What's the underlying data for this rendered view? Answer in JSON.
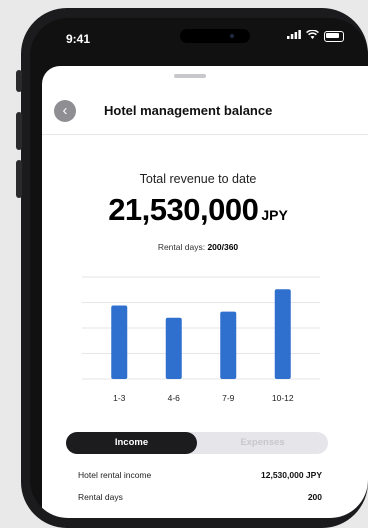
{
  "status": {
    "time": "9:41"
  },
  "header": {
    "title": "Hotel management balance"
  },
  "summary": {
    "revenue_label": "Total revenue to date",
    "amount": "21,530,000",
    "unit": "JPY",
    "rental_prefix": "Rental days:",
    "rental_value": "200/360"
  },
  "tabs": {
    "income": "Income",
    "expenses": "Expenses"
  },
  "rows": [
    {
      "label": "Hotel rental income",
      "value": "12,530,000 JPY"
    },
    {
      "label": "Rental days",
      "value": "200"
    }
  ],
  "chart_data": {
    "type": "bar",
    "categories": [
      "1-3",
      "4-6",
      "7-9",
      "10-12"
    ],
    "values": [
      72,
      60,
      66,
      88
    ],
    "ylim": [
      0,
      100
    ],
    "grid": true,
    "colors": {
      "bar": "#2f6fce",
      "grid": "#e6e6e8"
    }
  },
  "colors": {
    "accent": "#2f6fce",
    "toggle_active": "#1c1c1e"
  }
}
